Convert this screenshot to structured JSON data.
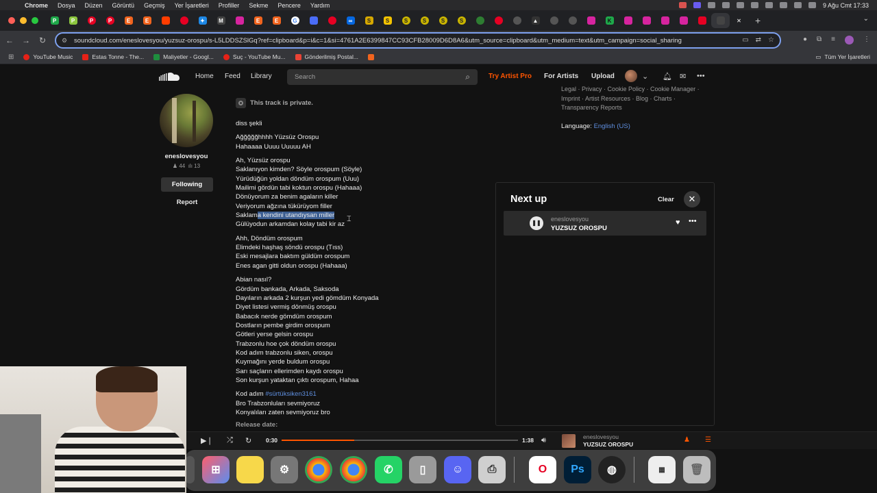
{
  "menubar": {
    "app": "Chrome",
    "items": [
      "Dosya",
      "Düzen",
      "Görüntü",
      "Geçmiş",
      "Yer İşaretleri",
      "Profiller",
      "Sekme",
      "Pencere",
      "Yardım"
    ],
    "clock": "9 Ağu Cmt  17:33"
  },
  "browser": {
    "url": "soundcloud.com/eneslovesyou/yuzsuz-orospu/s-L5LDDSZSlGq?ref=clipboard&p=i&c=1&si=4761A2E6399847CC93CFB28009D6D8A6&utm_source=clipboard&utm_medium=text&utm_campaign=social_sharing",
    "bookmarks": [
      "YouTube Music",
      "Estas Tonne - The...",
      "Maliyetler - Googl...",
      "Suç - YouTube Mu...",
      "Gönderilmiş Postal..."
    ],
    "bookmarks_right": "Tüm Yer İşaretleri"
  },
  "header": {
    "nav": [
      "Home",
      "Feed",
      "Library"
    ],
    "search_placeholder": "Search",
    "try_pro": "Try Artist Pro",
    "for_artists": "For Artists",
    "upload": "Upload"
  },
  "artist": {
    "name": "eneslovesyou",
    "followers": "44",
    "tracks": "13",
    "follow_label": "Following",
    "report_label": "Report"
  },
  "track": {
    "private_notice": "This track is private.",
    "release_label": "Release date:",
    "lyrics": [
      [
        "diss şekli"
      ],
      [
        "Ağğğğğhhhh Yüzsüz Orospu",
        "Hahaaaa Uuuu Uuuuu AH"
      ],
      [
        "Ah, Yüzsüz orospu",
        "Saklanıyon kimden? Söyle orospum (Söyle)",
        "Yürüdüğün yoldan döndüm orospum (Uuu)",
        "Mailimi gördün tabi koktun orospu (Hahaaa)",
        "Dönüyorum za benim agaların killer",
        "Veriyorum ağzına tükürüyom filler"
      ],
      [
        "Ahh, Döndüm orospum",
        "Elimdeki haşhaş söndü orospu (Tıss)",
        "Eski mesajlara baktım güldüm orospum",
        "Enes agan gitti oldun orospu (Hahaaa)"
      ],
      [
        "Abian nasıl?",
        "Gördüm bankada, Arkada, Saksoda",
        "Dayıların arkada 2 kurşun yedi gömdüm Konyada",
        "Diyet listesi vermiş dönmüş orospu",
        "Babacık nerde gömdüm orospum",
        "Dostların pembe girdim orospum",
        "Götleri yerse gelsin orospu",
        "Trabzonlu hoe çok döndüm orospu",
        "Kod adım trabzonlu siken, orospu",
        "Kuymağını yerde buldum orospu",
        "Sarı saçların ellerimden kaydı orospu",
        "Son kurşun yataktan çıktı orospum, Hahaa"
      ]
    ],
    "line_hl_pre": "Saklam",
    "line_hl_sel": "a kendini utandıysan miller",
    "line_after": "Gülüyodun arkamdan kolay tabi kir az",
    "tag_pre": "Kod adım ",
    "tag": "#sürtüksiken3161",
    "tag_lines": [
      "Bro Trabzonluları sevmiyoruz",
      "Konyalıları zaten sevmiyoruz bro"
    ]
  },
  "sidebar": {
    "footer_lines": [
      "Legal · Privacy · Cookie Policy · Cookie Manager ·",
      "Imprint · Artist Resources · Blog · Charts ·",
      "Transparency Reports"
    ],
    "language_label": "Language:",
    "language_value": "English (US)"
  },
  "nextup": {
    "title": "Next up",
    "clear": "Clear",
    "item_artist": "eneslovesyou",
    "item_title": "YUZSUZ OROSPU"
  },
  "player": {
    "elapsed": "0:30",
    "duration": "1:38",
    "progress": 0.306,
    "artist": "eneslovesyou",
    "title": "YUZSUZ OROSPU"
  },
  "colors": {
    "accent": "#ff5500",
    "link": "#5f8fe0",
    "selection": "#3d5f93"
  }
}
